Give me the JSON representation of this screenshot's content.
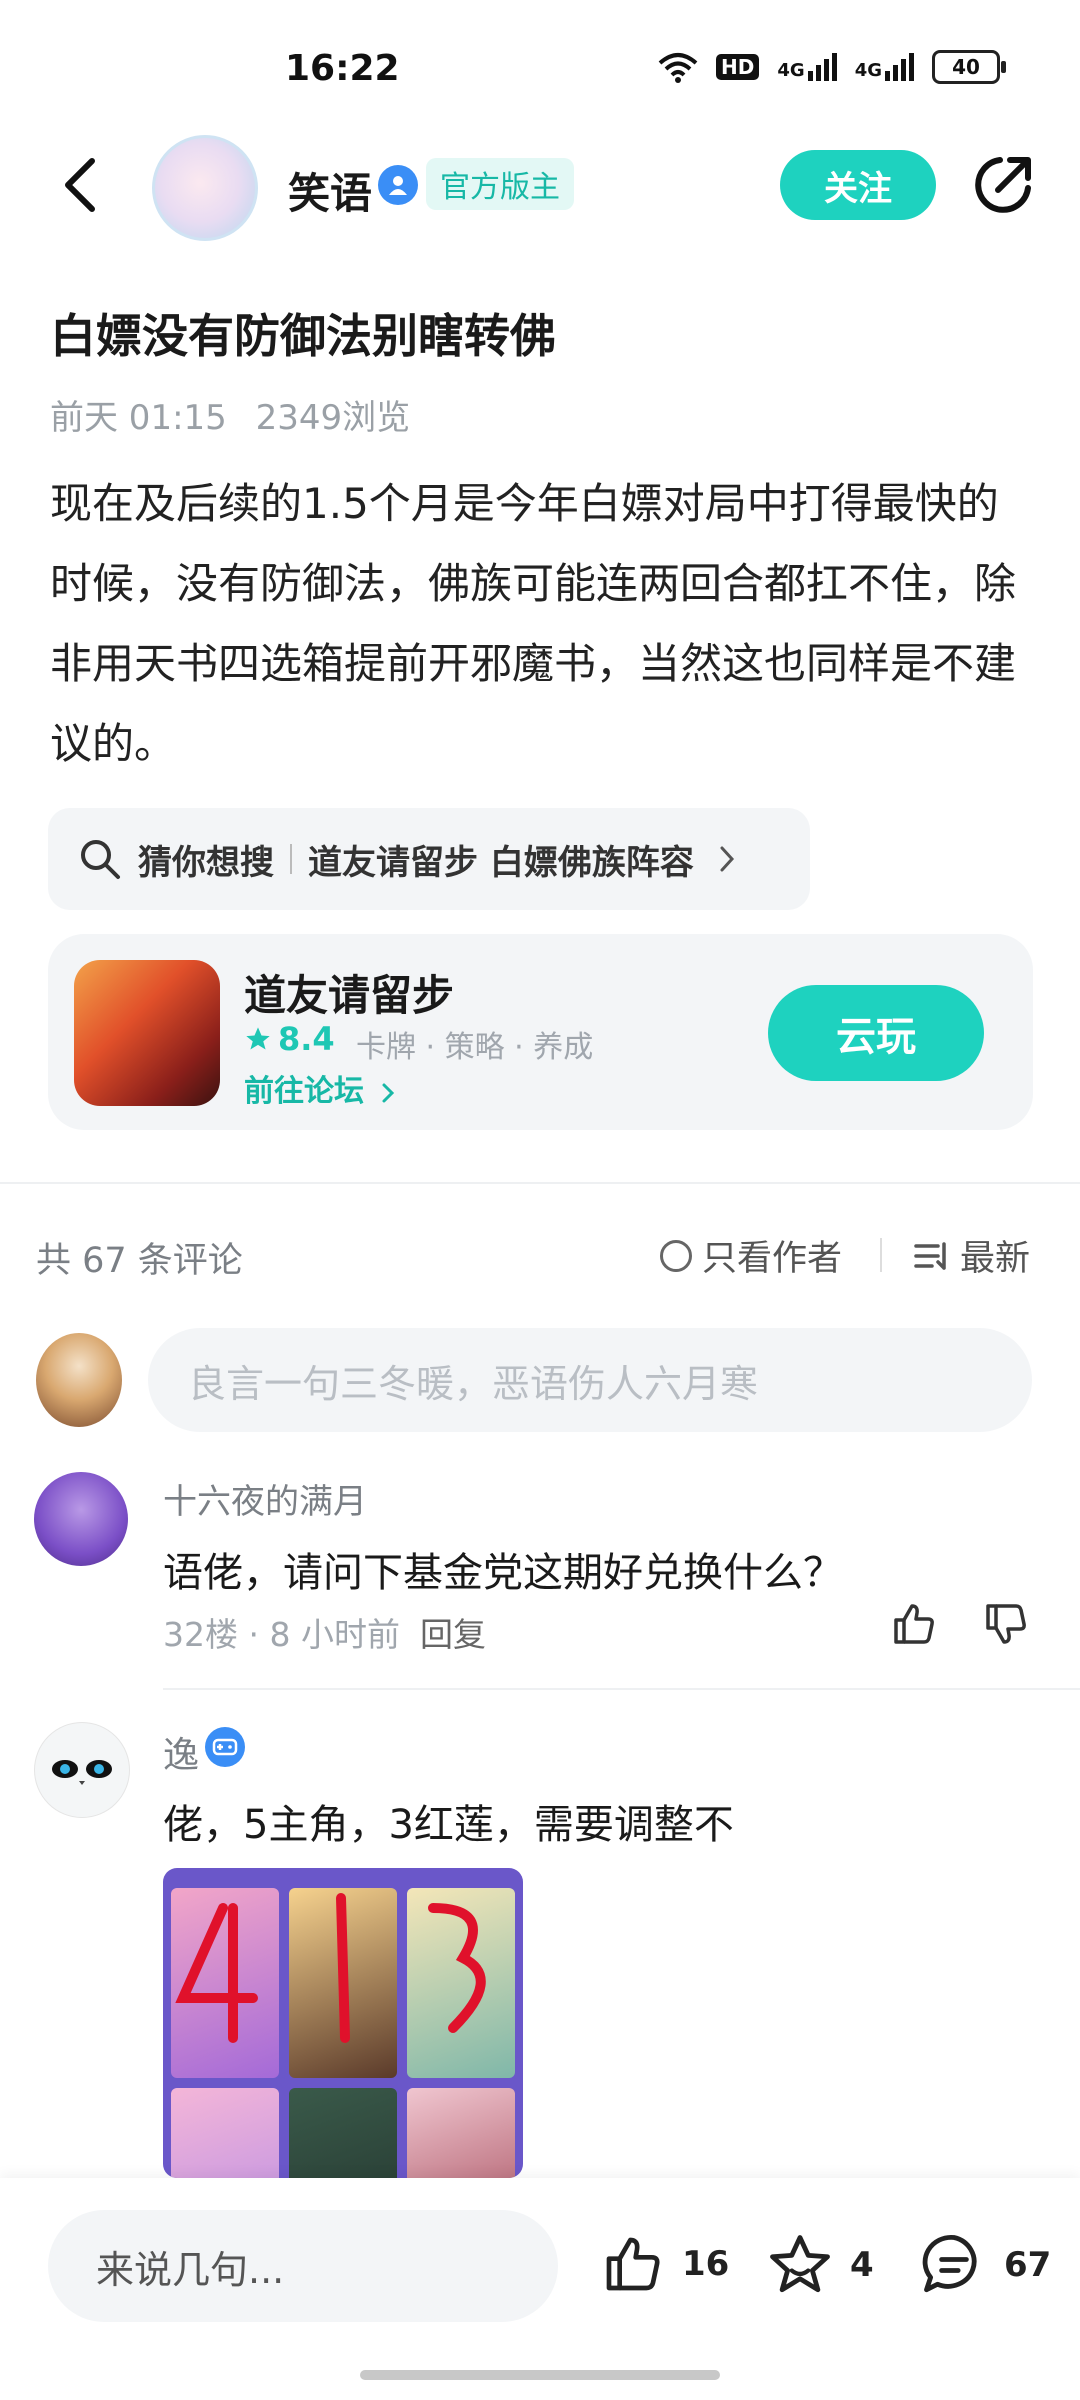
{
  "status_bar": {
    "time": "16:22",
    "network_hd": "HD",
    "signal1": "4G",
    "signal2": "4G",
    "battery": "40"
  },
  "header": {
    "author_name": "笑语",
    "mod_badge": "官方版主",
    "follow_label": "关注"
  },
  "post": {
    "title": "白嫖没有防御法别瞎转佛",
    "time": "前天 01:15",
    "views": "2349浏览",
    "body": "现在及后续的1.5个月是今年白嫖对局中打得最快的时候，没有防御法，佛族可能连两回合都扛不住，除非用天书四选箱提前开邪魔书，当然这也同样是不建议的。"
  },
  "search_hint": {
    "label": "猜你想搜",
    "query": "道友请留步 白嫖佛族阵容"
  },
  "game_card": {
    "name": "道友请留步",
    "rating": "8.4",
    "tags": "卡牌 · 策略 · 养成",
    "forum_link": "前往论坛",
    "play_label": "云玩"
  },
  "comments_header": {
    "count": "共 67 条评论",
    "author_only": "只看作者",
    "sort": "最新"
  },
  "comment_input": {
    "placeholder": "良言一句三冬暖，恶语伤人六月寒"
  },
  "comments": [
    {
      "name": "十六夜的满月",
      "text": "语佬，请问下基金党这期好兑换什么？",
      "meta": "32楼 · 8 小时前",
      "reply": "回复"
    },
    {
      "name": "逸",
      "text": "佬，5主角，3红莲，需要调整不"
    }
  ],
  "bottom_bar": {
    "input_placeholder": "来说几句...",
    "likes": "16",
    "favorites": "4",
    "comments": "67"
  },
  "colors": {
    "accent": "#1ed2bf",
    "verified": "#3a8ef6",
    "muted": "#a0a6ad"
  }
}
